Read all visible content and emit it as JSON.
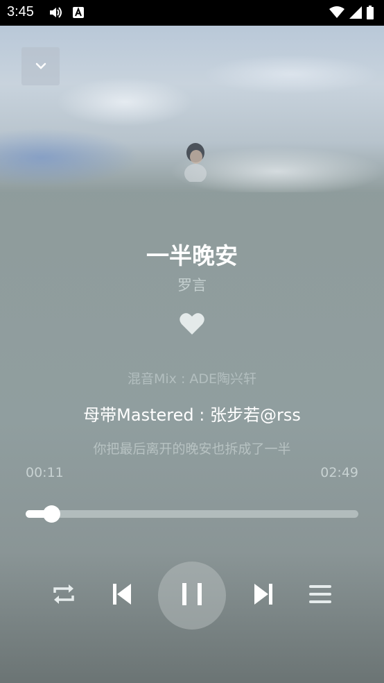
{
  "status_bar": {
    "time": "3:45",
    "icons": [
      "volume-icon",
      "a-notification-icon",
      "wifi-icon",
      "signal-icon",
      "battery-icon"
    ]
  },
  "header": {
    "collapse_icon": "chevron-down-icon"
  },
  "song": {
    "title": "一半晚安",
    "artist": "罗言"
  },
  "lyrics": {
    "previous": "混音Mix : ADE陶兴轩",
    "current": "母带Mastered : 张步若@rss",
    "next": "你把最后离开的晚安也拆成了一半"
  },
  "progress": {
    "current_time": "00:11",
    "total_time": "02:49",
    "fraction": 0.065
  },
  "controls": {
    "repeat_icon": "repeat-icon",
    "previous_icon": "skip-previous-icon",
    "pause_icon": "pause-icon",
    "next_icon": "skip-next-icon",
    "playlist_icon": "playlist-icon"
  },
  "colors": {
    "accent": "#ffffff",
    "background": "#8f9b9b"
  }
}
